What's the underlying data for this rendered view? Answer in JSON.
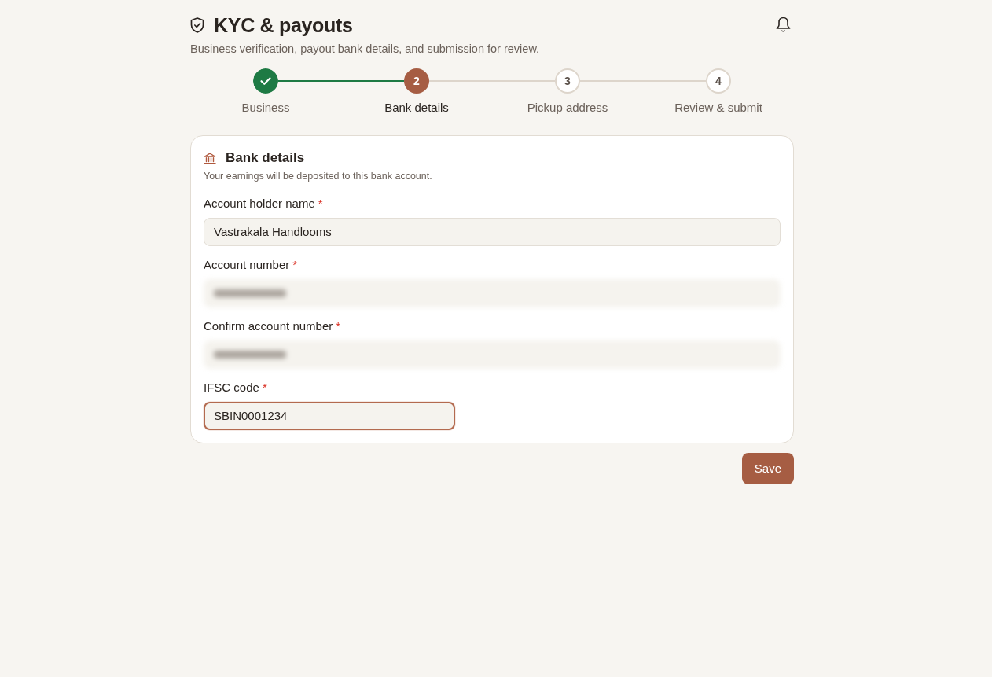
{
  "header": {
    "title": "KYC & payouts",
    "subtitle": "Business verification, payout bank details, and submission for review."
  },
  "steps": [
    {
      "label": "Business",
      "completed": true,
      "selected": false
    },
    {
      "number": "2",
      "label": "Bank details",
      "completed": false,
      "selected": true
    },
    {
      "number": "3",
      "label": "Pickup address",
      "completed": false,
      "selected": false
    },
    {
      "number": "4",
      "label": "Review & submit",
      "completed": false,
      "selected": false
    }
  ],
  "card": {
    "title": "Bank details",
    "description": "Your earnings will be deposited to this bank account.",
    "fields": [
      {
        "kind": "wide",
        "label": "Account holder name",
        "required_mark": "*",
        "value": "Vastrakala Handlooms",
        "blurred": false,
        "focused": false
      },
      {
        "kind": "wide",
        "label": "Account number",
        "required_mark": "*",
        "blurred": true,
        "focused": false
      },
      {
        "kind": "wide",
        "label": "Confirm account number",
        "required_mark": "*",
        "blurred": true,
        "focused": false
      },
      {
        "kind": "narrow",
        "label": "IFSC code",
        "required_mark": "*",
        "value": "SBIN0001234",
        "blurred": false,
        "focused": true
      }
    ]
  },
  "save_button": "Save"
}
